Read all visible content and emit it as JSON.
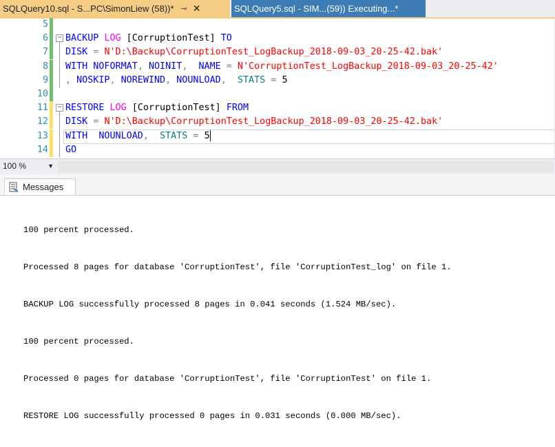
{
  "tabs": [
    {
      "label": "SQLQuery10.sql - S...PC\\SimonLiew (58))*",
      "pin": "⊸",
      "close": "✕",
      "active": true
    },
    {
      "label": "SQLQuery5.sql - SIM...(59)) Executing...*",
      "active": false
    }
  ],
  "editor": {
    "lines": [
      {
        "num": "5",
        "marker": "green",
        "fold": "",
        "tokens": []
      },
      {
        "num": "6",
        "marker": "green",
        "fold": "minus",
        "tokens": [
          {
            "t": "BACKUP ",
            "c": "kw"
          },
          {
            "t": "LOG",
            "c": "fn"
          },
          {
            "t": " [CorruptionTest] ",
            "c": "plain"
          },
          {
            "t": "TO",
            "c": "kw"
          }
        ]
      },
      {
        "num": "7",
        "marker": "green",
        "fold": "",
        "tokens": [
          {
            "t": "DISK ",
            "c": "kw"
          },
          {
            "t": "= ",
            "c": "gray"
          },
          {
            "t": "N'D:\\Backup\\CorruptionTest_LogBackup_2018-09-03_20-25-42.bak'",
            "c": "str"
          }
        ]
      },
      {
        "num": "8",
        "marker": "green",
        "fold": "",
        "tokens": [
          {
            "t": "WITH NOFORMAT",
            "c": "kw"
          },
          {
            "t": ", ",
            "c": "gray"
          },
          {
            "t": "NOINIT",
            "c": "kw"
          },
          {
            "t": ",  ",
            "c": "gray"
          },
          {
            "t": "NAME ",
            "c": "kw"
          },
          {
            "t": "= ",
            "c": "gray"
          },
          {
            "t": "N'CorruptionTest_LogBackup_2018-09-03_20-25-42'",
            "c": "str"
          }
        ]
      },
      {
        "num": "9",
        "marker": "green",
        "fold": "",
        "tokens": [
          {
            "t": ", ",
            "c": "gray"
          },
          {
            "t": "NOSKIP",
            "c": "kw"
          },
          {
            "t": ", ",
            "c": "gray"
          },
          {
            "t": "NOREWIND",
            "c": "kw"
          },
          {
            "t": ", ",
            "c": "gray"
          },
          {
            "t": "NOUNLOAD",
            "c": "kw"
          },
          {
            "t": ",  ",
            "c": "gray"
          },
          {
            "t": "STATS",
            "c": "grn"
          },
          {
            "t": " = ",
            "c": "gray"
          },
          {
            "t": "5",
            "c": "plain"
          }
        ]
      },
      {
        "num": "10",
        "marker": "green",
        "fold": "",
        "tokens": []
      },
      {
        "num": "11",
        "marker": "yellow",
        "fold": "minus",
        "tokens": [
          {
            "t": "RESTORE ",
            "c": "kw"
          },
          {
            "t": "LOG",
            "c": "fn"
          },
          {
            "t": " [CorruptionTest] ",
            "c": "plain"
          },
          {
            "t": "FROM",
            "c": "kw"
          }
        ]
      },
      {
        "num": "12",
        "marker": "yellow",
        "fold": "",
        "tokens": [
          {
            "t": "DISK ",
            "c": "kw"
          },
          {
            "t": "= ",
            "c": "gray"
          },
          {
            "t": "N'D:\\Backup\\CorruptionTest_LogBackup_2018-09-03_20-25-42.bak'",
            "c": "str"
          }
        ]
      },
      {
        "num": "13",
        "marker": "yellow",
        "fold": "",
        "current": true,
        "tokens": [
          {
            "t": "WITH  ",
            "c": "kw"
          },
          {
            "t": "NOUNLOAD",
            "c": "kw"
          },
          {
            "t": ",  ",
            "c": "gray"
          },
          {
            "t": "STATS",
            "c": "grn"
          },
          {
            "t": " = ",
            "c": "gray"
          },
          {
            "t": "5",
            "c": "plain"
          }
        ]
      },
      {
        "num": "14",
        "marker": "yellow",
        "fold": "",
        "tokens": [
          {
            "t": "GO",
            "c": "kw"
          }
        ]
      }
    ]
  },
  "zoom": {
    "value": "100 %",
    "arrow": "▼"
  },
  "results": {
    "tab_label": "Messages",
    "messages": [
      "100 percent processed.",
      "Processed 8 pages for database 'CorruptionTest', file 'CorruptionTest_log' on file 1.",
      "BACKUP LOG successfully processed 8 pages in 0.041 seconds (1.524 MB/sec).",
      "100 percent processed.",
      "Processed 0 pages for database 'CorruptionTest', file 'CorruptionTest' on file 1.",
      "RESTORE LOG successfully processed 0 pages in 0.031 seconds (0.000 MB/sec)."
    ]
  }
}
